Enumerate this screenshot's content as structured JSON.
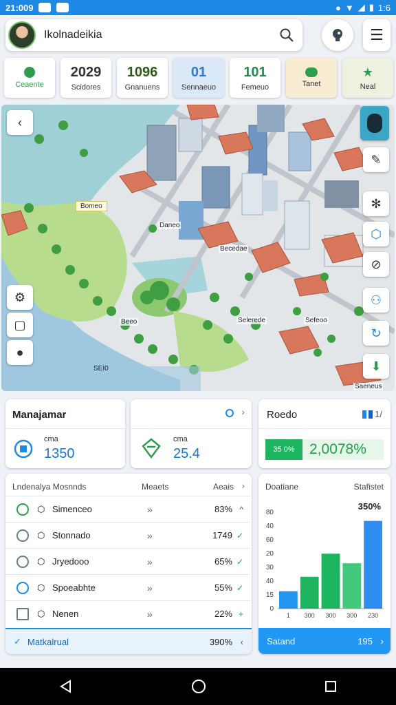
{
  "status_bar": {
    "time": "21:009",
    "right_text": "1:6"
  },
  "header": {
    "title": "Ikolnadeikia"
  },
  "stats": [
    {
      "value": "",
      "label": "Ceaente"
    },
    {
      "value": "2029",
      "label": "Scidores"
    },
    {
      "value": "1096",
      "label": "Gnanuens"
    },
    {
      "value": "01",
      "label": "Sennaeuo"
    },
    {
      "value": "101",
      "label": "Femeuo"
    },
    {
      "value": "",
      "label": "Tanet"
    },
    {
      "value": "",
      "label": "Neal"
    }
  ],
  "map": {
    "labels": {
      "callout": "Bomeo",
      "bottom": "SEI0",
      "p1": "Daneo",
      "p2": "Beeo",
      "p3": "Sel",
      "p4": "Becedae",
      "p5": "Sefeoo",
      "p6": "Selerede",
      "p7": "Saeneus"
    }
  },
  "management": {
    "title": "Manajamar",
    "mini1": "cma",
    "num1": "1350",
    "mini2": "cma",
    "num2": "25.4"
  },
  "rooted": {
    "title": "Roedo",
    "ratio": "1/",
    "badge": "35 0%",
    "value": "2,0078%"
  },
  "list": {
    "header_left": "Lndenalya Mosnnds",
    "header_mid": "Meaets",
    "header_right": "Aeais",
    "rows": [
      {
        "name": "Simenceo",
        "pct": "83%",
        "chev": "^"
      },
      {
        "name": "Stonnado",
        "pct": "1749",
        "chev": "✓"
      },
      {
        "name": "Jryedooo",
        "pct": "65%",
        "chev": "✓"
      },
      {
        "name": "Spoeabhte",
        "pct": "55%",
        "chev": "✓"
      },
      {
        "name": "Nenen",
        "pct": "22%",
        "chev": "+"
      }
    ],
    "footer_label": "Matkalrual",
    "footer_value": "390%"
  },
  "chart_panel": {
    "header_left": "Doatiane",
    "header_right": "Stafistet",
    "top_value": "350%",
    "footer_label": "Satand",
    "footer_value": "195"
  },
  "chart_data": {
    "type": "bar",
    "categories": [
      "1",
      "300",
      "300",
      "300",
      "230"
    ],
    "values": [
      18,
      33,
      57,
      47,
      91
    ],
    "ylim": [
      0,
      100
    ],
    "ytick_labels": [
      "0",
      "15",
      "40",
      "30",
      "20",
      "60",
      "40",
      "80"
    ],
    "colors": [
      "#2196f3",
      "#1eb560",
      "#1eb560",
      "#43c97d",
      "#2e8ef0"
    ]
  }
}
